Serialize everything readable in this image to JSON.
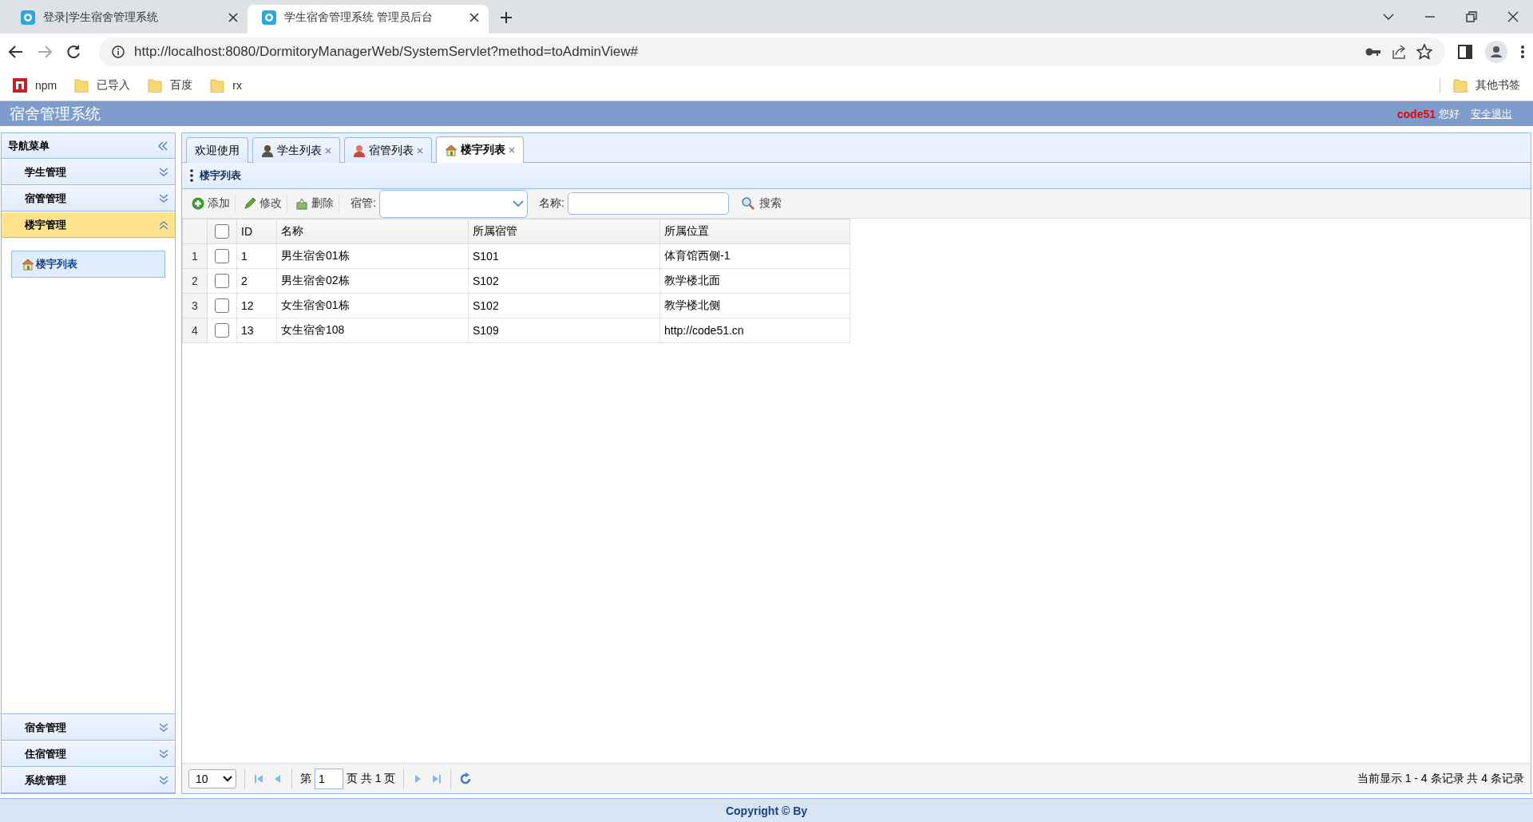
{
  "browser": {
    "tabs": [
      {
        "title": "登录|学生宿舍管理系统",
        "selected": false
      },
      {
        "title": "学生宿舍管理系统 管理员后台",
        "selected": true
      }
    ],
    "url": "http://localhost:8080/DormitoryManagerWeb/SystemServlet?method=toAdminView#",
    "bookmarks": [
      {
        "label": "npm",
        "kind": "npm"
      },
      {
        "label": "已导入",
        "kind": "folder"
      },
      {
        "label": "百度",
        "kind": "folder"
      },
      {
        "label": "rx",
        "kind": "folder"
      }
    ],
    "other_bookmarks": "其他书签"
  },
  "header": {
    "title": "宿舍管理系统",
    "user": "code51",
    "greeting": "您好",
    "logout": "安全退出"
  },
  "sidebar": {
    "title": "导航菜单",
    "sections": [
      {
        "label": "学生管理",
        "expanded": false
      },
      {
        "label": "宿管管理",
        "expanded": false
      },
      {
        "label": "楼宇管理",
        "expanded": true,
        "children": [
          {
            "label": "楼宇列表",
            "selected": true
          }
        ]
      },
      {
        "label": "宿舍管理",
        "expanded": false
      },
      {
        "label": "住宿管理",
        "expanded": false
      },
      {
        "label": "系统管理",
        "expanded": false
      }
    ]
  },
  "tabs": [
    {
      "label": "欢迎使用",
      "closable": false,
      "selected": false
    },
    {
      "label": "学生列表",
      "closable": true,
      "selected": false
    },
    {
      "label": "宿管列表",
      "closable": true,
      "selected": false
    },
    {
      "label": "楼宇列表",
      "closable": true,
      "selected": true
    }
  ],
  "panel": {
    "title": "楼宇列表",
    "toolbar": [
      {
        "label": "添加"
      },
      {
        "label": "修改"
      },
      {
        "label": "删除"
      }
    ],
    "filters": [
      {
        "label": "宿管:",
        "kind": "select"
      },
      {
        "label": "名称:",
        "kind": "text"
      }
    ],
    "search": "搜索",
    "table": {
      "all_checked": false,
      "columns": [
        "ID",
        "名称",
        "所属宿管",
        "所属位置"
      ],
      "rows": [
        {
          "num": "1",
          "checked": false,
          "cells": [
            "1",
            "男生宿舍01栋",
            "S101",
            "体育馆西侧-1"
          ]
        },
        {
          "num": "2",
          "checked": false,
          "cells": [
            "2",
            "男生宿舍02栋",
            "S102",
            "教学楼北面"
          ]
        },
        {
          "num": "3",
          "checked": false,
          "cells": [
            "12",
            "女生宿舍01栋",
            "S102",
            "教学楼北侧"
          ]
        },
        {
          "num": "4",
          "checked": false,
          "cells": [
            "13",
            "女生宿舍108",
            "S109",
            "http://code51.cn"
          ]
        }
      ]
    },
    "pager": {
      "page_size": "10",
      "page_prefix": "第",
      "page_value": "1",
      "page_suffix": "页 共 1 页",
      "info": "当前显示 1 - 4 条记录 共 4 条记录"
    }
  },
  "footer": "Copyright © By"
}
